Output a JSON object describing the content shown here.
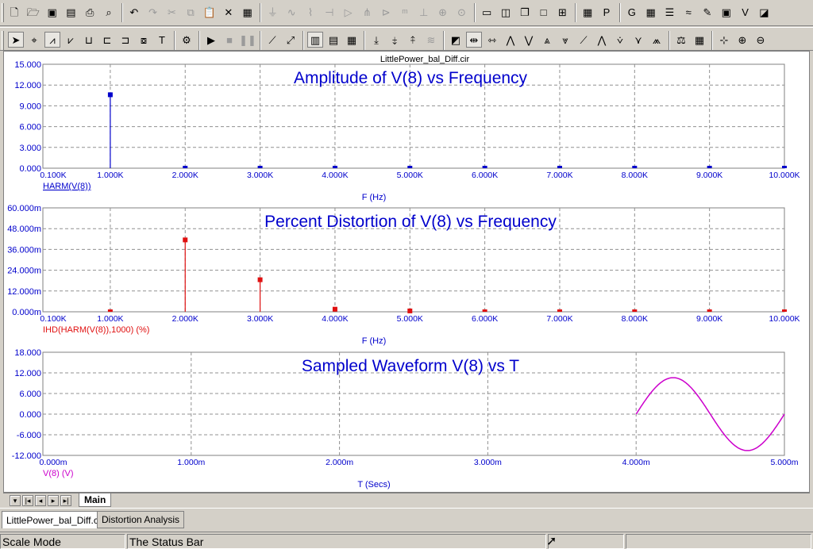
{
  "toolbar1": {
    "icons": [
      "new-file-icon",
      "open-file-icon",
      "save-icon",
      "save-all-icon",
      "print-icon",
      "print-preview-icon",
      "undo-icon",
      "redo-icon",
      "cut-icon",
      "copy-icon",
      "paste-icon",
      "delete-icon",
      "select-all-icon",
      "ground-icon",
      "wire-icon",
      "resistor-icon",
      "capacitor-icon",
      "diode-icon",
      "transistor-icon",
      "opamp-icon",
      "inductor-icon",
      "battery-icon",
      "source-icon",
      "probe-icon",
      "window-split-h-icon",
      "window-split-v-icon",
      "cascade-icon",
      "maximize-icon",
      "tile-icon",
      "calculator-icon",
      "p-icon",
      "g-icon",
      "grid-icon",
      "list-icon",
      "waveform-icon",
      "pen-icon",
      "image-icon",
      "vd-icon",
      "analysis-icon"
    ]
  },
  "toolbar2": {
    "icons": [
      "select-arrow-icon",
      "select-tool-icon",
      "plot-icon",
      "plot2-icon",
      "plot3-icon",
      "plot4-icon",
      "plot5-icon",
      "plot6-icon",
      "text-tool-icon",
      "properties-icon",
      "run-icon",
      "stop-icon",
      "pause-icon",
      "line-icon",
      "diagonal-icon",
      "table1-icon",
      "table2-icon",
      "table3-icon",
      "cursor1-icon",
      "cursor2-icon",
      "cursor3-icon",
      "cursor4-icon",
      "scope-icon",
      "arrows-icon",
      "arrows2-icon",
      "peak-icon",
      "valley-icon",
      "high-icon",
      "low-icon",
      "inflection-icon",
      "peak2-icon",
      "valley2-icon",
      "slope-icon",
      "sweep-icon",
      "scale-icon",
      "grid2-icon",
      "measure-icon",
      "zoom-in-icon",
      "zoom-out-icon"
    ]
  },
  "file_title": "LittlePower_bal_Diff.cir",
  "plots": [
    {
      "title": "Amplitude of V(8) vs Frequency",
      "trace_label": "HARM(V(8))",
      "xlabel": "F (Hz)",
      "color": "#0000cc",
      "y_ticks": [
        "15.000",
        "12.000",
        "9.000",
        "6.000",
        "3.000",
        "0.000"
      ],
      "x_ticks": [
        "0.100K",
        "1.000K",
        "2.000K",
        "3.000K",
        "4.000K",
        "5.000K",
        "6.000K",
        "7.000K",
        "8.000K",
        "9.000K",
        "10.000K"
      ]
    },
    {
      "title": "Percent Distortion of V(8) vs Frequency",
      "trace_label": "IHD(HARM(V(8)),1000) (%)",
      "xlabel": "F (Hz)",
      "color": "#e01010",
      "y_ticks": [
        "60.000m",
        "48.000m",
        "36.000m",
        "24.000m",
        "12.000m",
        "0.000m"
      ],
      "x_ticks": [
        "0.100K",
        "1.000K",
        "2.000K",
        "3.000K",
        "4.000K",
        "5.000K",
        "6.000K",
        "7.000K",
        "8.000K",
        "9.000K",
        "10.000K"
      ]
    },
    {
      "title": "Sampled Waveform  V(8) vs T",
      "trace_label": "V(8) (V)",
      "xlabel": "T (Secs)",
      "color": "#cc00cc",
      "y_ticks": [
        "18.000",
        "12.000",
        "6.000",
        "0.000",
        "-6.000",
        "-12.000"
      ],
      "x_ticks": [
        "0.000m",
        "1.000m",
        "2.000m",
        "3.000m",
        "4.000m",
        "5.000m"
      ]
    }
  ],
  "chart_data": [
    {
      "type": "bar",
      "title": "Amplitude of V(8) vs Frequency",
      "xlabel": "F (Hz)",
      "series": [
        {
          "name": "HARM(V(8))",
          "values": [
            10.6,
            0.0,
            0.0,
            0.0,
            0.0,
            0.0,
            0.0,
            0.0,
            0.0,
            0.0
          ]
        }
      ],
      "x": [
        1000,
        2000,
        3000,
        4000,
        5000,
        6000,
        7000,
        8000,
        9000,
        10000
      ],
      "xlim": [
        100,
        10000
      ],
      "ylim": [
        0,
        15
      ]
    },
    {
      "type": "bar",
      "title": "Percent Distortion of V(8) vs Frequency",
      "xlabel": "F (Hz)",
      "series": [
        {
          "name": "IHD(HARM(V(8)),1000) (%)",
          "values": [
            0.0,
            0.0415,
            0.0185,
            0.0015,
            0.0005,
            0.0,
            0.0,
            0.0,
            0.0,
            0.0
          ]
        }
      ],
      "x": [
        1000,
        2000,
        3000,
        4000,
        5000,
        6000,
        7000,
        8000,
        9000,
        10000
      ],
      "xlim": [
        100,
        10000
      ],
      "ylim": [
        0,
        0.06
      ]
    },
    {
      "type": "line",
      "title": "Sampled Waveform  V(8) vs T",
      "xlabel": "T (Secs)",
      "series": [
        {
          "name": "V(8) (V)",
          "amplitude": 10.6,
          "frequency_hz": 1000
        }
      ],
      "x_range_data": [
        0.004,
        0.005
      ],
      "xlim": [
        0,
        0.005
      ],
      "ylim": [
        -12,
        18
      ]
    }
  ],
  "sheet_tabs": {
    "main": "Main"
  },
  "doc_tabs": [
    "LittlePower_bal_Diff.cir",
    "Distortion Analysis"
  ],
  "status": {
    "mode": "Scale Mode",
    "message": "The Status Bar"
  }
}
